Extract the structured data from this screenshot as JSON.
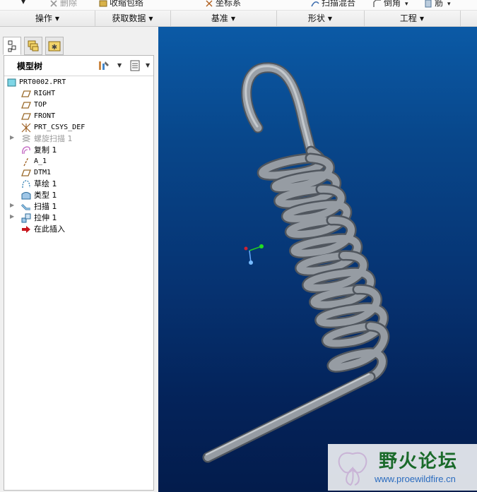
{
  "toolbar_top": {
    "items": [
      "删除",
      "收缩包络",
      "坐标系",
      "扫描混合",
      "倒角",
      "筋"
    ]
  },
  "groups": [
    "操作",
    "获取数据",
    "基准",
    "形状",
    "工程"
  ],
  "left_panel": {
    "tabs": [
      "model-tree-tab",
      "layers-tab",
      "favorites-tab"
    ],
    "tree_title": "模型树",
    "tree_items": [
      {
        "label": "PRT0002.PRT",
        "icon": "part-icon",
        "expandable": false
      },
      {
        "label": "RIGHT",
        "icon": "datum-plane-icon",
        "expandable": false
      },
      {
        "label": "TOP",
        "icon": "datum-plane-icon",
        "expandable": false
      },
      {
        "label": "FRONT",
        "icon": "datum-plane-icon",
        "expandable": false
      },
      {
        "label": "PRT_CSYS_DEF",
        "icon": "coordinate-system-icon",
        "expandable": false
      },
      {
        "label": "螺旋扫描 1",
        "icon": "helical-sweep-icon",
        "expandable": true,
        "suppressed": true
      },
      {
        "label": "复制 1",
        "icon": "copy-feature-icon",
        "expandable": false
      },
      {
        "label": "A_1",
        "icon": "datum-axis-icon",
        "expandable": false
      },
      {
        "label": "DTM1",
        "icon": "datum-plane-icon",
        "expandable": false
      },
      {
        "label": "草绘 1",
        "icon": "sketch-icon",
        "expandable": false
      },
      {
        "label": "类型 1",
        "icon": "type-feature-icon",
        "expandable": false
      },
      {
        "label": "扫描 1",
        "icon": "sweep-icon",
        "expandable": true
      },
      {
        "label": "拉伸 1",
        "icon": "extrude-icon",
        "expandable": true
      },
      {
        "label": "在此插入",
        "icon": "insert-here-arrow-icon",
        "expandable": false
      }
    ]
  },
  "watermark": {
    "title": "野火论坛",
    "url": "www.proewildfire.cn"
  },
  "colors": {
    "viewport_top": "#0b5aa6",
    "viewport_bottom": "#031c4c",
    "spring": "#8e949c",
    "insert_arrow": "#c8161d"
  }
}
